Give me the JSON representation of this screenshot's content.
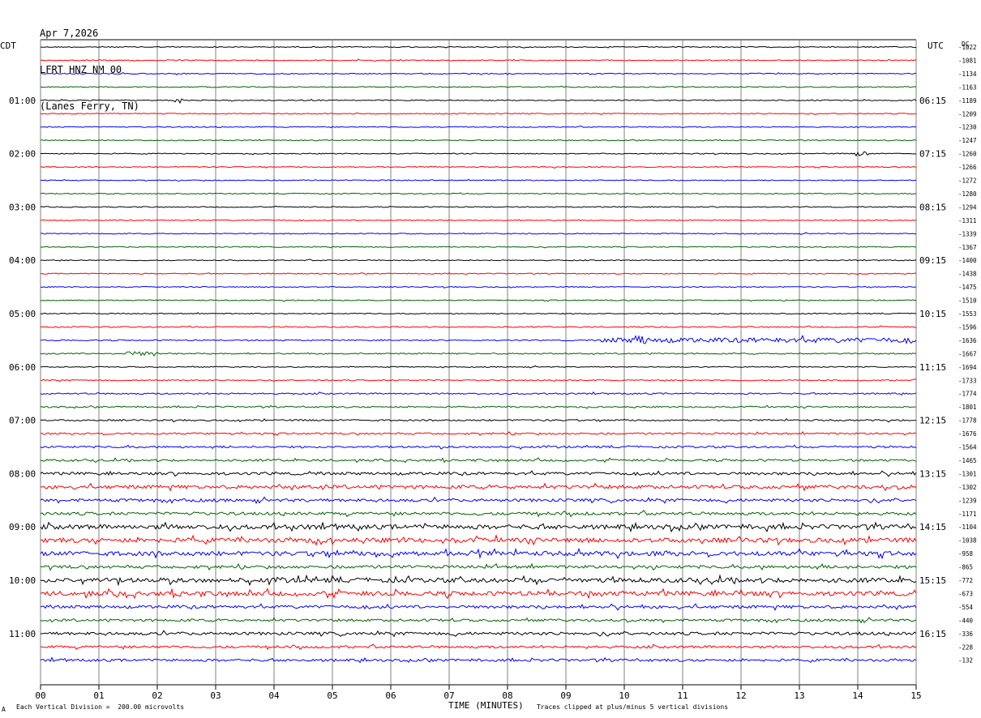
{
  "header": {
    "date": "Apr 7,2026",
    "station": "LFRT HNZ NM 00",
    "location": "(Lanes Ferry, TN)"
  },
  "labels": {
    "left_tz": "CDT",
    "right_tz": "UTC",
    "dc": "DC",
    "x_axis_title": "TIME (MINUTES)",
    "scale_note": "Each Vertical Division =  200.00 microvolts",
    "clip_note": "Traces clipped at plus/minus 5 vertical divisions",
    "corner_mark": "A"
  },
  "colors": {
    "cycle": [
      "#000000",
      "#ff0000",
      "#0000ff",
      "#006400"
    ],
    "grid": "#808080"
  },
  "chart_data": {
    "type": "line",
    "description": "helicorder",
    "x_ticks": [
      "00",
      "01",
      "02",
      "03",
      "04",
      "05",
      "06",
      "07",
      "08",
      "09",
      "10",
      "11",
      "12",
      "13",
      "14",
      "15"
    ],
    "xlim": [
      0,
      15
    ],
    "left_hour_labels": [
      "01:00",
      "02:00",
      "03:00",
      "04:00",
      "05:00",
      "06:00",
      "07:00",
      "08:00",
      "09:00",
      "10:00",
      "11:00"
    ],
    "right_hour_labels": [
      "06:15",
      "07:15",
      "08:15",
      "09:15",
      "10:15",
      "11:15",
      "12:15",
      "13:15",
      "14:15",
      "15:15",
      "16:15"
    ],
    "dc_offsets": [
      "-1022",
      "-1081",
      "-1134",
      "-1163",
      "-1189",
      "-1209",
      "-1230",
      "-1247",
      "-1260",
      "-1266",
      "-1272",
      "-1280",
      "-1294",
      "-1311",
      "-1339",
      "-1367",
      "-1400",
      "-1438",
      "-1475",
      "-1510",
      "-1553",
      "-1596",
      "-1636",
      "-1667",
      "-1694",
      "-1733",
      "-1774",
      "-1801",
      "-1778",
      "-1676",
      "-1564",
      "-1465",
      "-1301",
      "-1302",
      "-1239",
      "-1171",
      "-1104",
      "-1038",
      "-958",
      "-865",
      "-772",
      "-673",
      "-554",
      "-440",
      "-336",
      "-228",
      "-132"
    ],
    "trace_noise_level": [
      1,
      1,
      1,
      1,
      1,
      1,
      1,
      1,
      1,
      1,
      1,
      1,
      1,
      1,
      1,
      1,
      1,
      1,
      1,
      1,
      1,
      1.2,
      1.2,
      1.3,
      1,
      1.2,
      1.5,
      1.5,
      1.6,
      1.8,
      2,
      2.2,
      2.8,
      3.5,
      3,
      3,
      4.5,
      4.5,
      4.5,
      3,
      4.5,
      4.5,
      3,
      2.5,
      3,
      2.5,
      2.5,
      2
    ]
  }
}
